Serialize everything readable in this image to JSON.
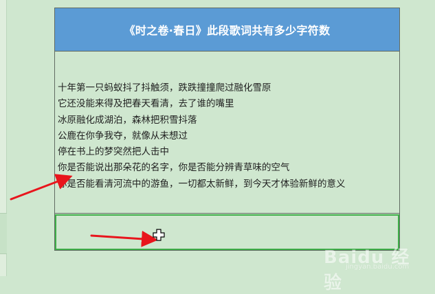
{
  "title": "《时之卷·春日》此段歌词共有多少字符数",
  "lyrics": [
    "十年第一只蚂蚁抖了抖触须，跌跌撞撞爬过融化雪原",
    "它还没能来得及把春天看清，去了谁的嘴里",
    "冰原融化成湖泊，森林把积雪抖落",
    "公鹿在你争我夺，就像从未想过",
    "停在书上的梦突然把人击中",
    "你是否能说出那朵花的名字，你是否能分辨青草味的空气",
    "你是否能看清河流中的游鱼，一切都太新鲜，到今天才体验新鲜的意义"
  ],
  "answer_cell_value": "",
  "watermark": {
    "brand": "Baidu 经验",
    "url": "jingyan.baidu.com"
  },
  "colors": {
    "title_bg": "#5b9bd5",
    "sheet_bg": "#cfe7cf",
    "selection_border": "#3fae49",
    "arrow": "#e8151c"
  },
  "icons": {
    "cursor": "cell-select-cross-cursor",
    "annotation": "red-arrow"
  }
}
